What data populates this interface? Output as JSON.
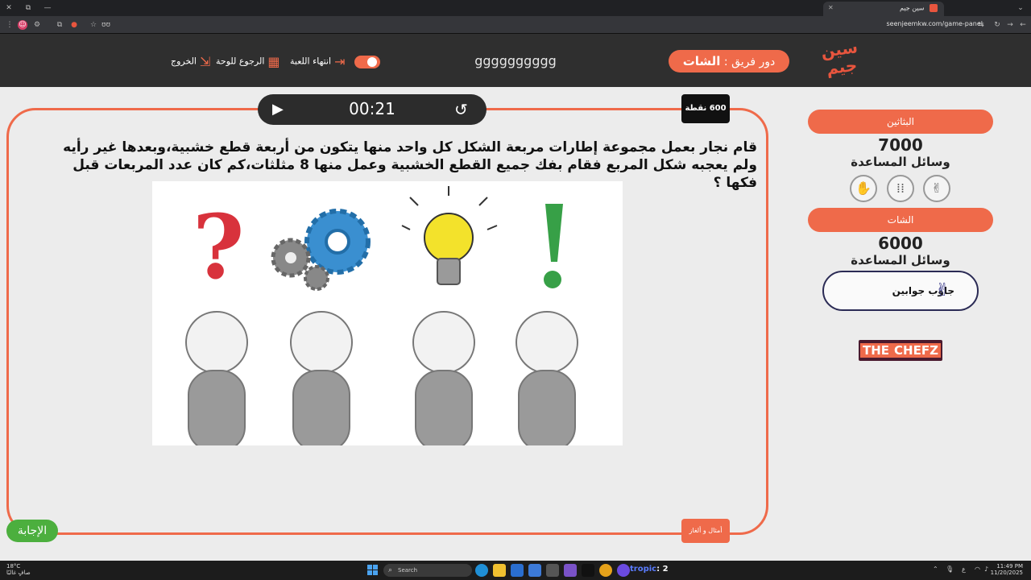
{
  "browser": {
    "tab_title": "سين جيم",
    "url": "seenjeemkw.com/game-panel",
    "short_url": "ʊʊ"
  },
  "header": {
    "logo_text": "سين جيم",
    "team_turn_label": "دور فريق :",
    "team_turn_name": "الشات",
    "team_name_center": "gggggggggg",
    "end_game_label": "انتهاء اللعبة",
    "back_to_board_label": "الرجوع للوحة",
    "exit_label": "الخروج"
  },
  "teams": [
    {
      "name": "البثاثين",
      "score": "7000",
      "helpers_label": "وسائل المساعدة"
    },
    {
      "name": "الشات",
      "score": "6000",
      "helpers_label": "وسائل المساعدة",
      "lifeline_label": "جاوب جوابين"
    }
  ],
  "sponsor": {
    "part1": "THE",
    "part2": "CHEFZ"
  },
  "question": {
    "timer": "00:21",
    "points": "600 نقطة",
    "text": "قام نجار بعمل مجموعة إطارات مربعة الشكل كل واحد منها يتكون من أربعة قطع خشبية،وبعدها غير رأيه ولم يعجبه شكل المربع فقام بفك جميع القطع الخشبية وعمل منها 8 مثلثات،كم كان عدد المربعات قبل فكها ؟",
    "examples_label": "أمثال و ألغاز",
    "answer_label": "الإجابة"
  },
  "taskbar": {
    "weather_temp": "18°C",
    "weather_desc": "صافٍ غالبًا",
    "search_placeholder": "Search",
    "tropic_label": "tropic",
    "tropic_count": ": 2",
    "time": "11:49 PM",
    "date": "11/20/2025"
  },
  "colors": {
    "accent": "#ef6a4a",
    "header_bg": "#2f2f2f",
    "page_bg": "#ececec",
    "answer_green": "#4caf3e"
  },
  "icons": {
    "play": "play-icon",
    "reset": "history-icon",
    "lifelines": [
      "hand-stop-icon",
      "footsteps-icon",
      "peace-hand-icon"
    ]
  }
}
